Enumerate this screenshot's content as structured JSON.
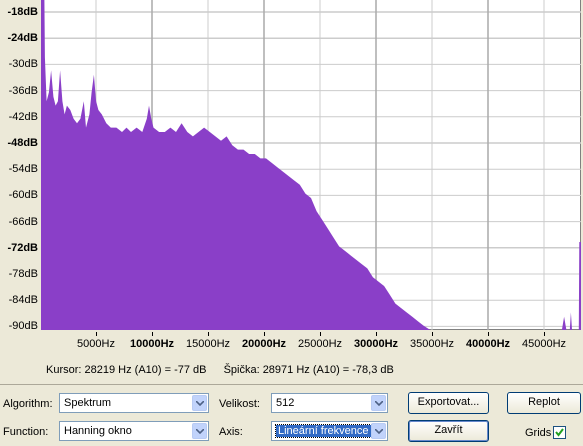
{
  "chart_data": {
    "type": "area",
    "y_ticks": [
      {
        "label": "-18dB",
        "bold": true
      },
      {
        "label": "-24dB",
        "bold": true
      },
      {
        "label": "-30dB",
        "bold": false
      },
      {
        "label": "-36dB",
        "bold": false
      },
      {
        "label": "-42dB",
        "bold": false
      },
      {
        "label": "-48dB",
        "bold": true
      },
      {
        "label": "-54dB",
        "bold": false
      },
      {
        "label": "-60dB",
        "bold": false
      },
      {
        "label": "-66dB",
        "bold": false
      },
      {
        "label": "-72dB",
        "bold": true
      },
      {
        "label": "-78dB",
        "bold": false
      },
      {
        "label": "-84dB",
        "bold": false
      },
      {
        "label": "-90dB",
        "bold": false
      }
    ],
    "x_ticks": [
      {
        "label": "5000Hz",
        "bold": false
      },
      {
        "label": "10000Hz",
        "bold": true
      },
      {
        "label": "15000Hz",
        "bold": false
      },
      {
        "label": "20000Hz",
        "bold": true
      },
      {
        "label": "25000Hz",
        "bold": false
      },
      {
        "label": "30000Hz",
        "bold": true
      },
      {
        "label": "35000Hz",
        "bold": false
      },
      {
        "label": "40000Hz",
        "bold": true
      },
      {
        "label": "45000Hz",
        "bold": false
      }
    ],
    "xlim": [
      0,
      48000
    ],
    "ylim": [
      -92,
      -17
    ],
    "fill_color": "#8a3fc8",
    "grid": true,
    "series_points": [
      [
        0,
        -17
      ],
      [
        300,
        -17
      ],
      [
        350,
        -30
      ],
      [
        500,
        -40
      ],
      [
        700,
        -38
      ],
      [
        900,
        -33
      ],
      [
        1100,
        -39
      ],
      [
        1300,
        -41
      ],
      [
        1500,
        -40
      ],
      [
        1700,
        -33
      ],
      [
        1900,
        -40
      ],
      [
        2100,
        -43
      ],
      [
        2300,
        -41
      ],
      [
        2600,
        -42
      ],
      [
        2900,
        -44
      ],
      [
        3200,
        -45
      ],
      [
        3500,
        -44
      ],
      [
        3800,
        -40
      ],
      [
        4000,
        -46
      ],
      [
        4300,
        -43
      ],
      [
        4500,
        -38
      ],
      [
        4700,
        -34
      ],
      [
        4900,
        -40
      ],
      [
        5100,
        -42
      ],
      [
        5400,
        -43
      ],
      [
        5800,
        -45
      ],
      [
        6200,
        -46
      ],
      [
        6700,
        -46
      ],
      [
        7200,
        -47
      ],
      [
        7600,
        -46
      ],
      [
        8000,
        -47
      ],
      [
        8500,
        -46
      ],
      [
        9000,
        -47
      ],
      [
        9400,
        -44
      ],
      [
        9600,
        -41
      ],
      [
        9800,
        -44
      ],
      [
        10000,
        -46
      ],
      [
        10500,
        -47
      ],
      [
        11000,
        -47
      ],
      [
        11500,
        -46
      ],
      [
        12000,
        -47
      ],
      [
        12500,
        -45
      ],
      [
        13000,
        -47
      ],
      [
        13500,
        -48
      ],
      [
        14000,
        -47
      ],
      [
        14500,
        -46
      ],
      [
        15000,
        -47
      ],
      [
        15500,
        -48
      ],
      [
        16000,
        -49
      ],
      [
        16500,
        -48
      ],
      [
        17000,
        -50
      ],
      [
        17500,
        -51
      ],
      [
        18000,
        -51
      ],
      [
        18500,
        -52
      ],
      [
        19000,
        -52
      ],
      [
        19500,
        -53
      ],
      [
        20000,
        -53
      ],
      [
        20500,
        -54
      ],
      [
        21000,
        -55
      ],
      [
        21500,
        -56
      ],
      [
        22000,
        -57
      ],
      [
        22500,
        -58
      ],
      [
        23000,
        -59
      ],
      [
        23500,
        -61
      ],
      [
        24000,
        -62
      ],
      [
        24500,
        -65
      ],
      [
        25000,
        -67
      ],
      [
        25500,
        -69
      ],
      [
        26000,
        -71
      ],
      [
        26500,
        -73
      ],
      [
        27000,
        -74
      ],
      [
        27500,
        -75
      ],
      [
        28000,
        -76
      ],
      [
        28500,
        -77
      ],
      [
        29000,
        -78
      ],
      [
        29500,
        -80
      ],
      [
        30000,
        -81
      ],
      [
        30500,
        -82
      ],
      [
        31000,
        -84
      ],
      [
        31500,
        -86
      ],
      [
        32000,
        -87
      ],
      [
        32500,
        -88
      ],
      [
        33000,
        -89
      ],
      [
        33500,
        -90
      ],
      [
        34000,
        -91
      ],
      [
        34600,
        -92
      ],
      [
        46300,
        -92
      ],
      [
        46500,
        -89
      ],
      [
        46700,
        -92
      ],
      [
        47000,
        -92
      ],
      [
        47100,
        -88
      ],
      [
        47200,
        -92
      ],
      [
        47800,
        -92
      ],
      [
        47850,
        -72
      ],
      [
        48000,
        -72
      ]
    ]
  },
  "status": {
    "cursor": "Kursor: 28219 Hz (A10) = -77 dB",
    "peak": "Špička: 28971 Hz (A10) = -78,3 dB"
  },
  "controls": {
    "algorithm_label": "Algorithm:",
    "algorithm_value": "Spektrum",
    "size_label": "Velikost:",
    "size_value": "512",
    "export_button": "Exportovat...",
    "replot_button": "Replot",
    "function_label": "Function:",
    "function_value": "Hanning okno",
    "axis_label": "Axis:",
    "axis_value": "Lineární frekvence",
    "close_button": "Zavřít",
    "grids_label": "Grids",
    "grids_checked": true
  }
}
